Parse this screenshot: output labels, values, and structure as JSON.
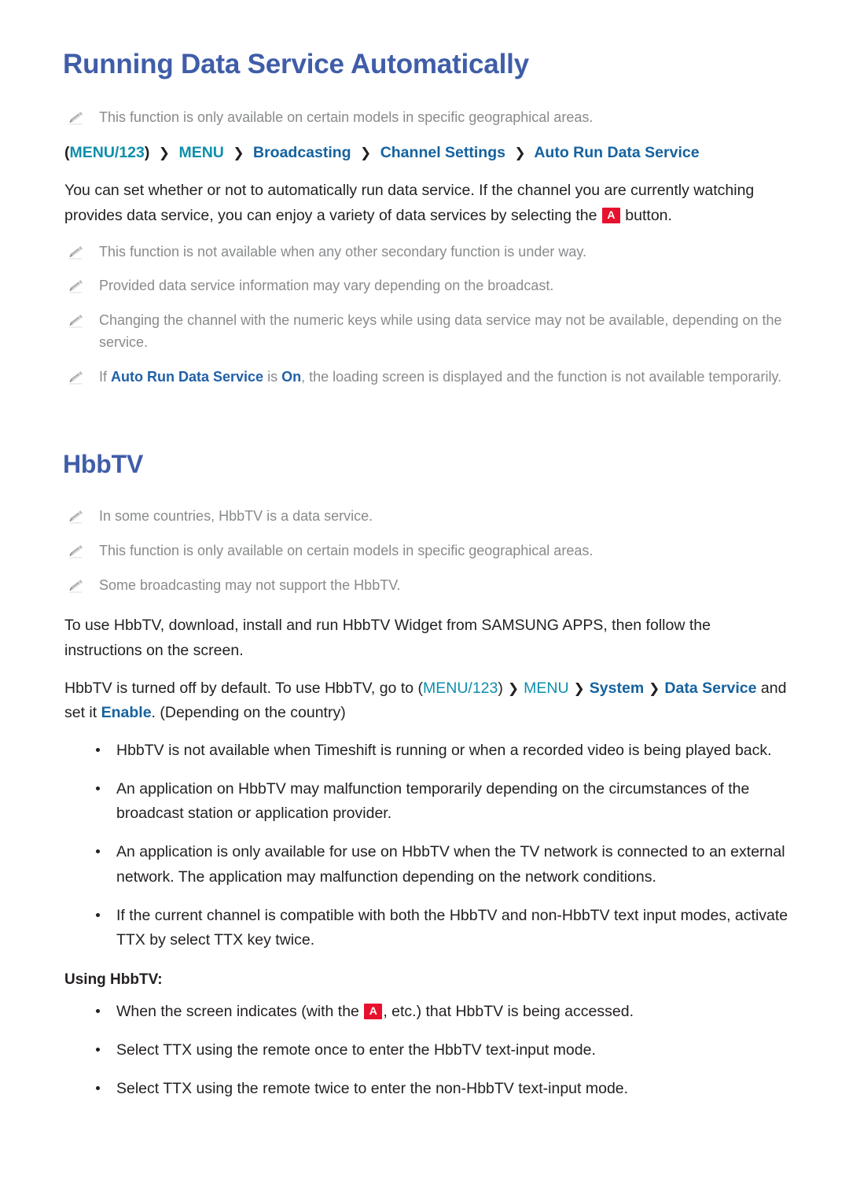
{
  "document": {
    "title": "Running Data Service Automatically",
    "section_title": "HbbTV"
  },
  "colors": {
    "heading_blue": "#3f5da8",
    "crumb_teal": "#0e8fab",
    "crumb_blue": "#15629f",
    "note_gray": "#888a8c",
    "key_red": "#e8112d",
    "body_black": "#231f20"
  },
  "notes_top": [
    {
      "icon": "pencil-icon",
      "text": "This function is only available on certain models in specific geographical areas."
    }
  ],
  "breadcrumb": {
    "name": "menu-path-auto-run-data-service",
    "open_paren": "(",
    "menu123": "MENU/123",
    "close_paren": ")",
    "chevron": "❯",
    "items": [
      "MENU",
      "Broadcasting",
      "Channel Settings",
      "Auto Run Data Service"
    ]
  },
  "intro_paragraph": {
    "part1": "You can set whether or not to automatically run data service. If the channel you are currently watching provides data service, you can enjoy a variety of data services by selecting the ",
    "key": "A",
    "part2": " button."
  },
  "notes_mid": [
    {
      "icon": "pencil-icon",
      "text": "This function is not available when any other secondary function is under way."
    },
    {
      "icon": "pencil-icon",
      "text": "Provided data service information may vary depending on the broadcast."
    },
    {
      "icon": "pencil-icon",
      "text": "Changing the channel with the numeric keys while using data service may not be available, depending on the service."
    }
  ],
  "note_auto_run": {
    "icon": "pencil-icon",
    "lead": "If ",
    "hl1": "Auto Run Data Service",
    "mid": " is ",
    "hl2": "On",
    "tail": ", the loading screen is displayed and the function is not available temporarily."
  },
  "notes_hbbtv": [
    {
      "icon": "pencil-icon",
      "text": "In some countries, HbbTV is a data service."
    },
    {
      "icon": "pencil-icon",
      "text": "This function is only available on certain models in specific geographical areas."
    },
    {
      "icon": "pencil-icon",
      "text": "Some broadcasting may not support the HbbTV."
    }
  ],
  "hbbtv_intro": "To use HbbTV, download, install and run HbbTV Widget from SAMSUNG APPS, then follow the instructions on the screen.",
  "hbbtv_setup": {
    "lead": "HbbTV is turned off by default. To use HbbTV, go to ",
    "open_paren": "(",
    "menu123": "MENU/123",
    "close_paren": ")",
    "chevron": "❯",
    "items": [
      "MENU",
      "System",
      "Data Service"
    ],
    "mid": " and set it ",
    "enable": "Enable",
    "tail": ". (Depending on the country)"
  },
  "hbbtv_bullets": [
    "HbbTV is not available when Timeshift is running or when a recorded video is being played back.",
    "An application on HbbTV may malfunction temporarily depending on the circumstances of the broadcast station or application provider.",
    "An application is only available for use on HbbTV when the TV network is connected to an external network. The application may malfunction depending on the network conditions.",
    "If the current channel is compatible with both the HbbTV and non-HbbTV text input modes, activate TTX by select TTX key twice."
  ],
  "using_hbbtv": {
    "heading": "Using HbbTV:",
    "bullet1": {
      "part1": "When the screen indicates (with the ",
      "key": "A",
      "part2": ", etc.) that HbbTV is being accessed."
    },
    "bullets": [
      "Select TTX using the remote once to enter the HbbTV text-input mode.",
      "Select TTX using the remote twice to enter the non-HbbTV text-input mode."
    ]
  }
}
